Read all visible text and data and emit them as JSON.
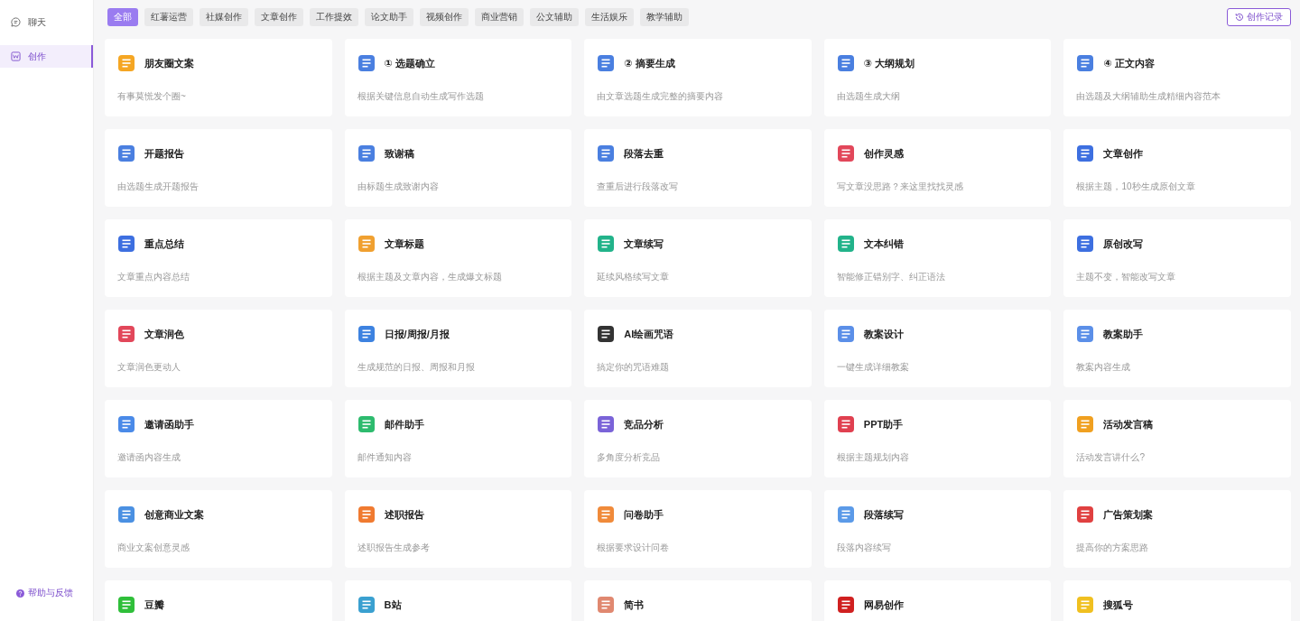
{
  "sidebar": {
    "items": [
      {
        "label": "聊天",
        "kind": "chat",
        "selected": false
      },
      {
        "label": "创作",
        "kind": "write",
        "selected": true
      }
    ],
    "help": {
      "label": "帮助与反馈"
    }
  },
  "filters": [
    {
      "label": "全部",
      "selected": true
    },
    {
      "label": "红薯运营",
      "selected": false
    },
    {
      "label": "社媒创作",
      "selected": false
    },
    {
      "label": "文章创作",
      "selected": false
    },
    {
      "label": "工作提效",
      "selected": false
    },
    {
      "label": "论文助手",
      "selected": false
    },
    {
      "label": "视频创作",
      "selected": false
    },
    {
      "label": "商业营销",
      "selected": false
    },
    {
      "label": "公文辅助",
      "selected": false
    },
    {
      "label": "生活娱乐",
      "selected": false
    },
    {
      "label": "教学辅助",
      "selected": false
    }
  ],
  "history_button": {
    "label": "创作记录"
  },
  "cards": [
    {
      "title": "朋友圈文案",
      "description": "有事莫慌发个圈~",
      "color": "#f5a623"
    },
    {
      "title": "① 选题确立",
      "description": "根据关键信息自动生成写作选题",
      "color": "#4a7fe0"
    },
    {
      "title": "② 摘要生成",
      "description": "由文章选题生成完整的摘要内容",
      "color": "#4a7fe0"
    },
    {
      "title": "③ 大纲规划",
      "description": "由选题生成大纲",
      "color": "#4a7fe0"
    },
    {
      "title": "④ 正文内容",
      "description": "由选题及大纲辅助生成精细内容范本",
      "color": "#4a7fe0"
    },
    {
      "title": "开题报告",
      "description": "由选题生成开题报告",
      "color": "#4a7fe0"
    },
    {
      "title": "致谢稿",
      "description": "由标题生成致谢内容",
      "color": "#4a7fe0"
    },
    {
      "title": "段落去重",
      "description": "查重后进行段落改写",
      "color": "#4a7fe0"
    },
    {
      "title": "创作灵感",
      "description": "写文章没思路？来这里找找灵感",
      "color": "#e2475a"
    },
    {
      "title": "文章创作",
      "description": "根据主题，10秒生成原创文章",
      "color": "#3d6fe0"
    },
    {
      "title": "重点总结",
      "description": "文章重点内容总结",
      "color": "#3d6fe0"
    },
    {
      "title": "文章标题",
      "description": "根据主题及文章内容，生成爆文标题",
      "color": "#f0a030"
    },
    {
      "title": "文章续写",
      "description": "延续风格续写文章",
      "color": "#22b38a"
    },
    {
      "title": "文本纠错",
      "description": "智能修正错别字、纠正语法",
      "color": "#22b38a"
    },
    {
      "title": "原创改写",
      "description": "主题不变，智能改写文章",
      "color": "#3d6fe0"
    },
    {
      "title": "文章润色",
      "description": "文章润色更动人",
      "color": "#e2475a"
    },
    {
      "title": "日报/周报/月报",
      "description": "生成规范的日报、周报和月报",
      "color": "#3d82e0"
    },
    {
      "title": "AI绘画咒语",
      "description": "搞定你的咒语难题",
      "color": "#333333"
    },
    {
      "title": "教案设计",
      "description": "一键生成详细教案",
      "color": "#5b8fe8"
    },
    {
      "title": "教案助手",
      "description": "教案内容生成",
      "color": "#5b8fe8"
    },
    {
      "title": "邀请函助手",
      "description": "邀请函内容生成",
      "color": "#4a8ae8"
    },
    {
      "title": "邮件助手",
      "description": "邮件通知内容",
      "color": "#2dbb6e"
    },
    {
      "title": "竞品分析",
      "description": "多角度分析竞品",
      "color": "#7a63d8"
    },
    {
      "title": "PPT助手",
      "description": "根据主题规划内容",
      "color": "#e04050"
    },
    {
      "title": "活动发言稿",
      "description": "活动发言讲什么?",
      "color": "#f0a020"
    },
    {
      "title": "创意商业文案",
      "description": "商业文案创意灵感",
      "color": "#4a90e2"
    },
    {
      "title": "述职报告",
      "description": "述职报告生成参考",
      "color": "#f07a30"
    },
    {
      "title": "问卷助手",
      "description": "根据要求设计问卷",
      "color": "#f08a3a"
    },
    {
      "title": "段落续写",
      "description": "段落内容续写",
      "color": "#5b9ae8"
    },
    {
      "title": "广告策划案",
      "description": "提高你的方案思路",
      "color": "#e04040"
    },
    {
      "title": "豆瓣",
      "color": "#2fbf3a"
    },
    {
      "title": "B站",
      "color": "#3aa0d0"
    },
    {
      "title": "简书",
      "color": "#e08870"
    },
    {
      "title": "网易创作",
      "color": "#d02020"
    },
    {
      "title": "搜狐号",
      "color": "#f0c020"
    }
  ]
}
